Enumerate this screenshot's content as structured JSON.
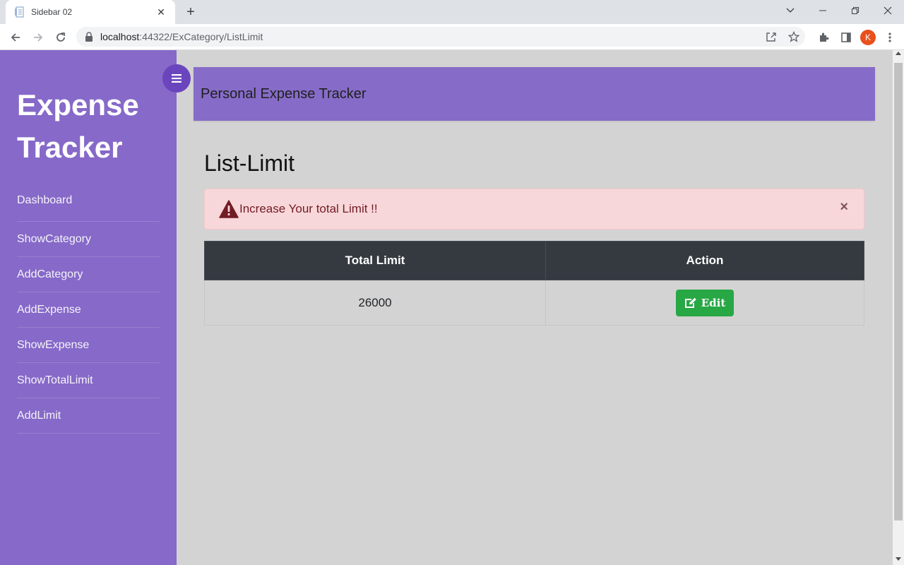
{
  "browser": {
    "tab_title": "Sidebar 02",
    "url_host": "localhost",
    "url_path": ":44322/ExCategory/ListLimit",
    "profile_initial": "K"
  },
  "sidebar": {
    "brand_line1": "Expense",
    "brand_line2": "Tracker",
    "items": [
      {
        "label": "Dashboard"
      },
      {
        "label": "ShowCategory"
      },
      {
        "label": "AddCategory"
      },
      {
        "label": "AddExpense"
      },
      {
        "label": "ShowExpense"
      },
      {
        "label": "ShowTotalLimit"
      },
      {
        "label": "AddLimit"
      }
    ]
  },
  "topbar": {
    "title": "Personal Expense Tracker"
  },
  "main": {
    "heading": "List-Limit",
    "alert": {
      "text": "Increase Your total Limit !!",
      "close": "×"
    },
    "table": {
      "headers": [
        "Total Limit",
        "Action"
      ],
      "rows": [
        {
          "total_limit": "26000",
          "action_label": "Edit"
        }
      ]
    }
  },
  "colors": {
    "sidebar": "#8669c8",
    "topbar": "#866cc8",
    "toggle": "#6a45bd",
    "alert_bg": "#f8d7da",
    "table_header": "#343a40",
    "edit_button": "#28a745"
  },
  "icons": {
    "tab_favicon": "document-icon",
    "alert": "warning-triangle-icon",
    "edit": "pencil-square-icon",
    "toggle": "hamburger-menu-icon"
  }
}
